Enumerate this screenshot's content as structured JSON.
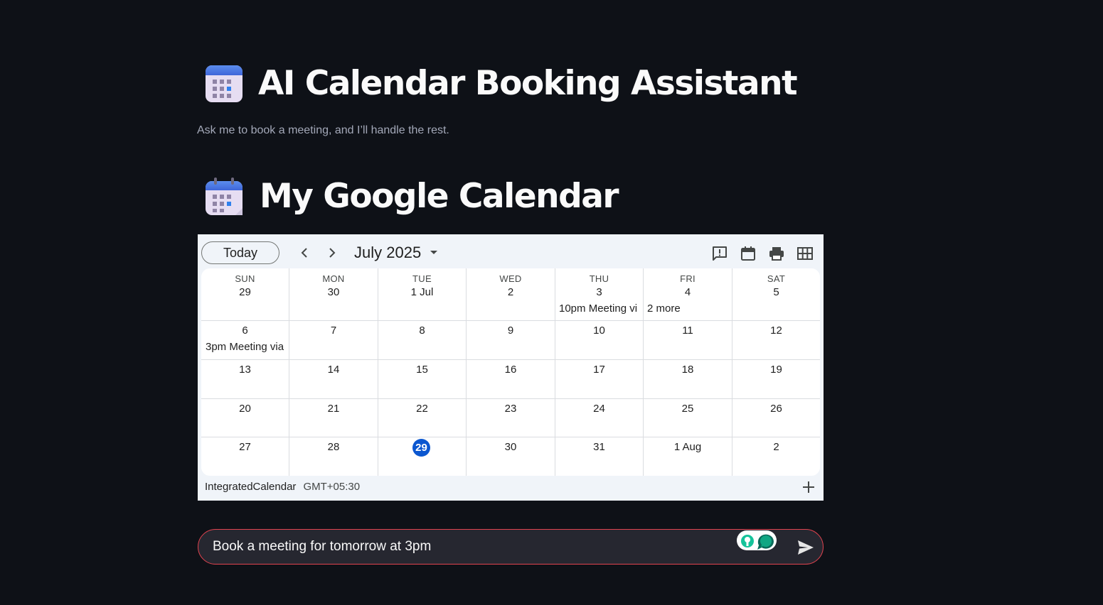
{
  "header": {
    "title": "AI Calendar Booking Assistant",
    "subtitle": "Ask me to book a meeting, and I’ll handle the rest.",
    "title_icon": "calendar-emoji-icon"
  },
  "section": {
    "title": "My Google Calendar",
    "title_icon": "calendar-emoji-icon"
  },
  "calendar": {
    "today_label": "Today",
    "month_label": "July 2025",
    "weekdays": [
      "SUN",
      "MON",
      "TUE",
      "WED",
      "THU",
      "FRI",
      "SAT"
    ],
    "weeks": [
      [
        "29",
        "30",
        "1 Jul",
        "2",
        "3",
        "4",
        "5"
      ],
      [
        "6",
        "7",
        "8",
        "9",
        "10",
        "11",
        "12"
      ],
      [
        "13",
        "14",
        "15",
        "16",
        "17",
        "18",
        "19"
      ],
      [
        "20",
        "21",
        "22",
        "23",
        "24",
        "25",
        "26"
      ],
      [
        "27",
        "28",
        "29",
        "30",
        "31",
        "1 Aug",
        "2"
      ]
    ],
    "events": {
      "thu3_time": "10pm",
      "thu3_name": "Meeting vi",
      "fri4_more": "2 more",
      "sun6_time": "3pm",
      "sun6_name": "Meeting via"
    },
    "calendar_name": "IntegratedCalendar",
    "timezone": "GMT+05:30",
    "today_highlight_color": "#0b57d0",
    "toolbar_icons": [
      "feedback-icon",
      "calendar-view-icon",
      "print-icon",
      "grid-view-icon"
    ]
  },
  "chat": {
    "value": "Book a meeting for tomorrow at 3pm",
    "border_color": "#e0434f",
    "extension_icon": "grammarly-extension-icon",
    "send_icon": "send-icon"
  }
}
